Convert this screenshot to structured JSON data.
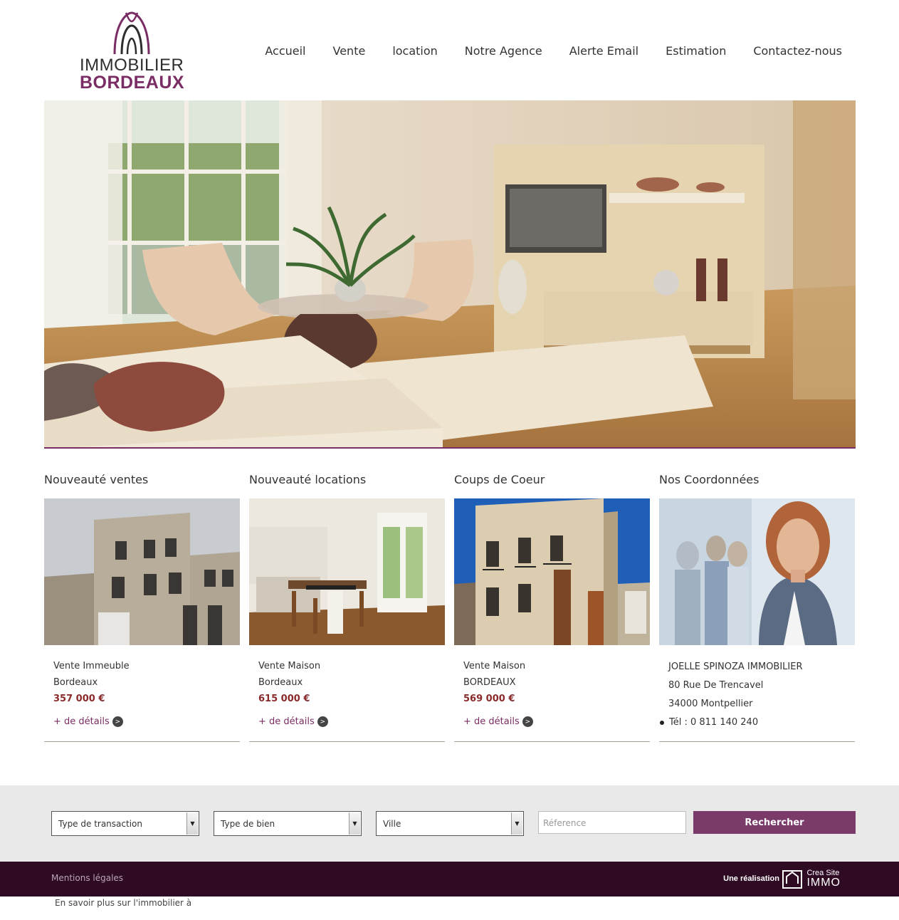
{
  "logo": {
    "line1": "IMMOBILIER",
    "line2": "BORDEAUX",
    "icon": "arch-logo-icon"
  },
  "nav": [
    "Accueil",
    "Vente",
    "location",
    "Notre Agence",
    "Alerte Email",
    "Estimation",
    "Contactez-nous"
  ],
  "colors": {
    "brand": "#7a2d64",
    "price": "#8b2a2a",
    "footer": "#2f0a23",
    "button": "#7a3a6a"
  },
  "sections": {
    "sales": {
      "title": "Nouveauté ventes",
      "type": "Vente Immeuble",
      "city": "Bordeaux",
      "price": "357 000 €",
      "details": "+ de détails"
    },
    "rentals": {
      "title": "Nouveauté locations",
      "type": "Vente Maison",
      "city": "Bordeaux",
      "price": "615 000 €",
      "details": "+ de détails"
    },
    "favorites": {
      "title": "Coups de Coeur",
      "type": "Vente Maison",
      "city": "BORDEAUX",
      "price": "569 000 €",
      "details": "+ de détails"
    },
    "contact": {
      "title": "Nos Coordonnées",
      "name": "JOELLE SPINOZA IMMOBILIER",
      "street": "80 Rue De Trencavel",
      "city": "34000 Montpellier",
      "phone": "Tél : 0 811 140 240"
    }
  },
  "search": {
    "transaction": "Type de transaction",
    "property": "Type de bien",
    "city": "Ville",
    "reference_placeholder": "Réference",
    "button": "Rechercher"
  },
  "footer": {
    "mentions": "Mentions légales",
    "realisation": "Une réalisation",
    "brand_line1": "Crea Site",
    "brand_line2": "IMMO"
  },
  "more": "En savoir plus sur l'immobilier à"
}
